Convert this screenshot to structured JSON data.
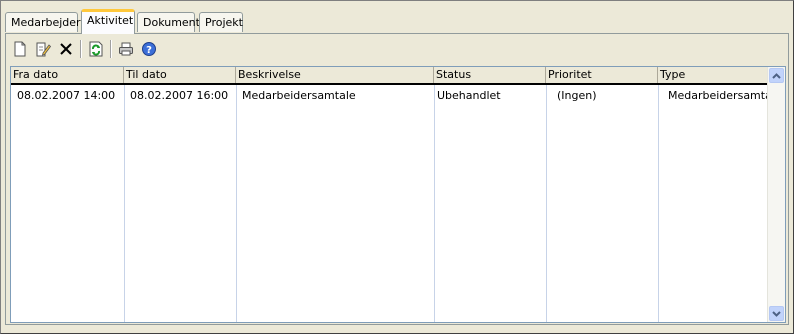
{
  "tabs": [
    {
      "label": "Medarbejder"
    },
    {
      "label": "Aktivitet"
    },
    {
      "label": "Dokument"
    },
    {
      "label": "Projekt"
    }
  ],
  "active_tab": "Aktivitet",
  "toolbar": {
    "icons": [
      "new-document-icon",
      "edit-document-icon",
      "delete-icon",
      "refresh-icon",
      "print-icon",
      "help-icon"
    ]
  },
  "table": {
    "columns": [
      "Fra dato",
      "Til dato",
      "Beskrivelse",
      "Status",
      "Prioritet",
      "Type"
    ],
    "rows": [
      [
        "08.02.2007 14:00",
        "08.02.2007 16:00",
        "Medarbeidersamtale",
        "Ubehandlet",
        "(Ingen)",
        "Medarbeidersamtale"
      ]
    ]
  },
  "colors": {
    "accent_tab": "#ffc83c",
    "panel_bg": "#ece9d8",
    "grid_border": "#7f9db9"
  }
}
